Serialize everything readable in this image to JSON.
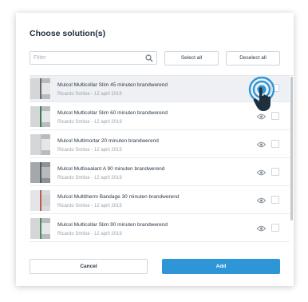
{
  "dialog": {
    "title": "Choose solution(s)",
    "search_placeholder": "Filter",
    "select_all_label": "Select all",
    "deselect_all_label": "Deselect all",
    "cancel_label": "Cancel",
    "add_label": "Add"
  },
  "solutions": [
    {
      "title": "Mulcol Multicollar Slim 45 minuten brandwerend",
      "subtitle": "Ricardo Smitse - 12 april 2019"
    },
    {
      "title": "Mulcol Multicollar Slim 60 minuten brandwerend",
      "subtitle": "Ricardo Smitse - 12 april 2019"
    },
    {
      "title": "Mulcol Multimortar 20 minuten brandwerend",
      "subtitle": "Ricardo Smitse - 12 april 2019"
    },
    {
      "title": "Mulcol Multisealant A 90 minuten brandwerend",
      "subtitle": "Ricardo Smitse - 12 april 2019"
    },
    {
      "title": "Mulcol Multitherm Bandage 30 minuten brandwerend",
      "subtitle": "Ricardo Smitse - 12 april 2019"
    },
    {
      "title": "Mulcol Multicollar Slim 90 minuten brandwerend",
      "subtitle": "Ricardo Smitse - 12 april 2019"
    }
  ],
  "colors": {
    "primary": "#2e95d6",
    "touch_indicator": "#2e95d6",
    "selected_row": "#eef0f3"
  },
  "icons": {
    "search": "magnifier-icon",
    "preview": "eye-icon",
    "touch": "tap-gesture-icon"
  }
}
